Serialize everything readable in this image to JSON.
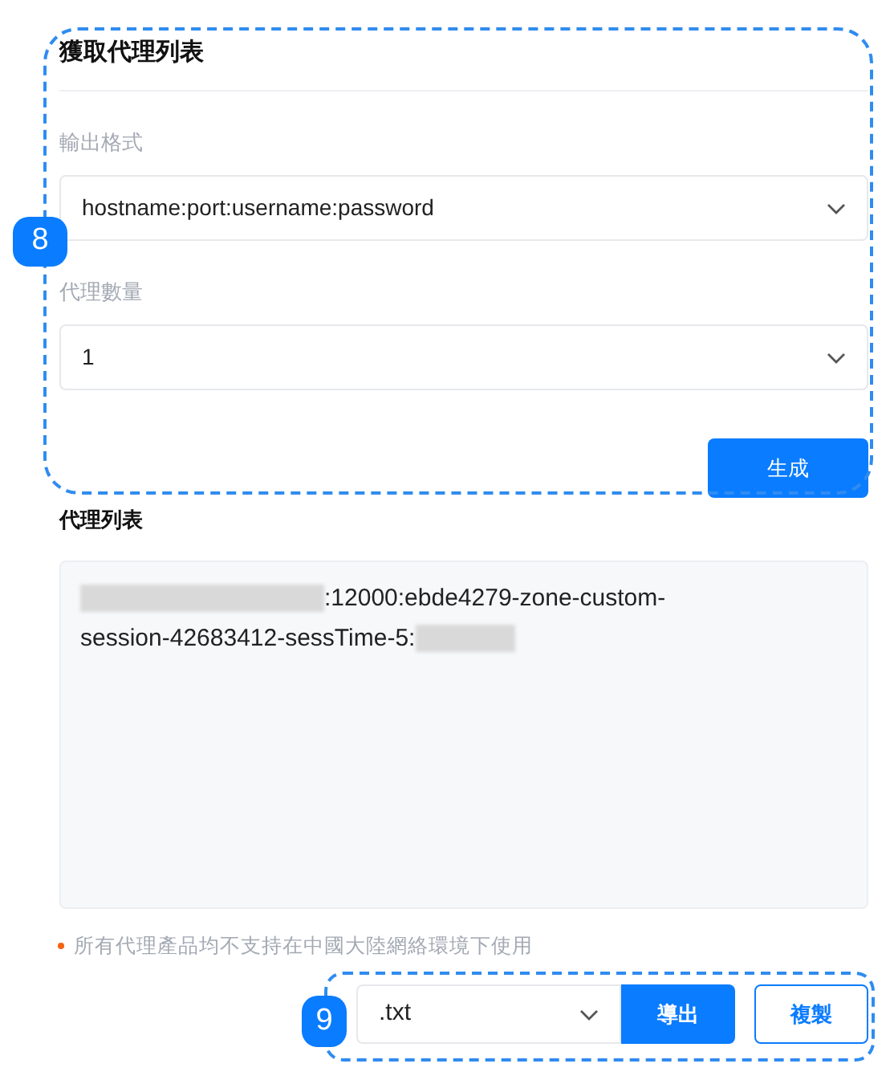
{
  "annotations": [
    {
      "label": "8"
    },
    {
      "label": "9"
    }
  ],
  "form": {
    "title": "獲取代理列表",
    "fields": [
      {
        "label": "輸出格式",
        "value": "hostname:port:username:password"
      },
      {
        "label": "代理數量",
        "value": "1"
      }
    ],
    "generate_button": "生成"
  },
  "proxy_list": {
    "label": "代理列表",
    "lines": [
      ":12000:ebde4279-zone-custom-",
      "session-42683412-sessTime-5:"
    ]
  },
  "note": "所有代理產品均不支持在中國大陸網絡環境下使用",
  "export": {
    "format": ".txt",
    "export_button": "導出",
    "copy_button": "複製"
  }
}
